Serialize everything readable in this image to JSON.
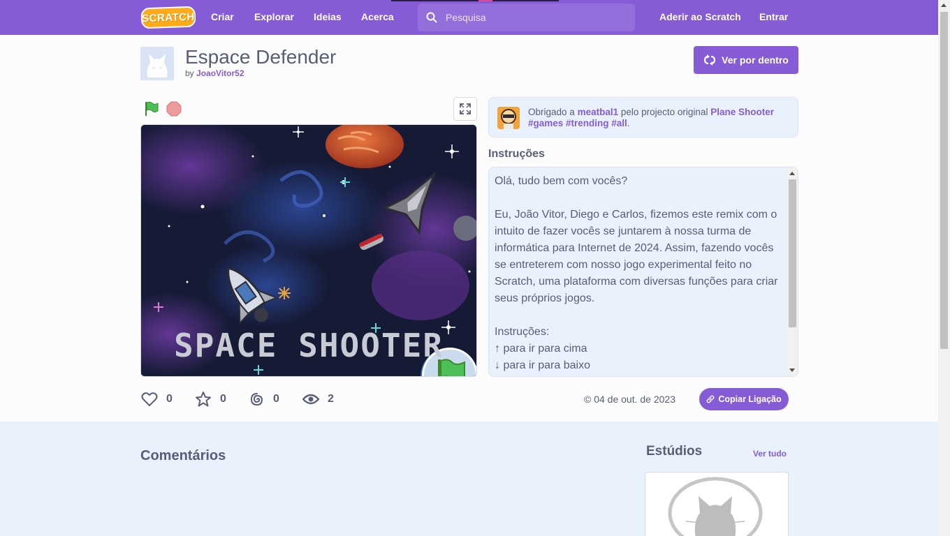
{
  "nav": {
    "logo_text": "SCRATCH",
    "links": [
      "Criar",
      "Explorar",
      "Ideias",
      "Acerca"
    ],
    "search_placeholder": "Pesquisa",
    "join": "Aderir ao Scratch",
    "signin": "Entrar"
  },
  "project": {
    "title": "Espace Defender",
    "by_prefix": "by",
    "author": "JoaoVitor52",
    "see_inside": "Ver por dentro",
    "stage_title": "SPACE SHOOTER"
  },
  "credit": {
    "prefix": "Obrigado a",
    "user": "meatbal1",
    "middle": "pelo projecto original",
    "project": "Plane Shooter",
    "tags": "#games #trending #all",
    "end": "."
  },
  "instructions": {
    "title": "Instruções",
    "text": "Olá, tudo bem com vocês?\n\nEu, João Vitor, Diego e Carlos, fizemos este remix com o intuito de fazer vocês se juntarem à nossa turma de informática para Internet de 2024. Assim, fazendo vocês se entreterem com nosso jogo experimental feito no Scratch, uma plataforma com diversas funções para criar seus próprios jogos.\n\nInstruções:\n↑ para ir para cima\n↓ para ir para baixo"
  },
  "stats": {
    "loves": "0",
    "favorites": "0",
    "remixes": "0",
    "views": "2"
  },
  "date": "© 04 de out. de 2023",
  "copy_link": "Copiar Ligação",
  "lower": {
    "comments_title": "Comentários",
    "studios_title": "Estúdios",
    "see_all": "Ver tudo"
  },
  "colors": {
    "brand": "#855cd6",
    "text": "#575e75",
    "panel": "#e9f1fc"
  }
}
